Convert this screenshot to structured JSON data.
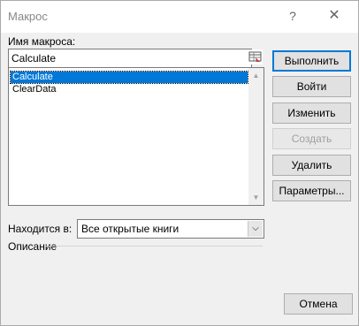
{
  "window": {
    "title": "Макрос",
    "help_label": "?",
    "close_label": "✕"
  },
  "form": {
    "macro_name_label": "Имя макроса:",
    "macro_name_value": "Calculate",
    "macros": [
      "Calculate",
      "ClearData"
    ],
    "selected_index": 0,
    "location_label": "Находится в:",
    "location_value": "Все открытые книги",
    "description_label": "Описание"
  },
  "buttons": {
    "run": "Выполнить",
    "step_into": "Войти",
    "edit": "Изменить",
    "create": "Создать",
    "delete": "Удалить",
    "options": "Параметры...",
    "cancel": "Отмена"
  },
  "colors": {
    "accent": "#0078d7",
    "dialog_bg": "#f0f0f0"
  }
}
